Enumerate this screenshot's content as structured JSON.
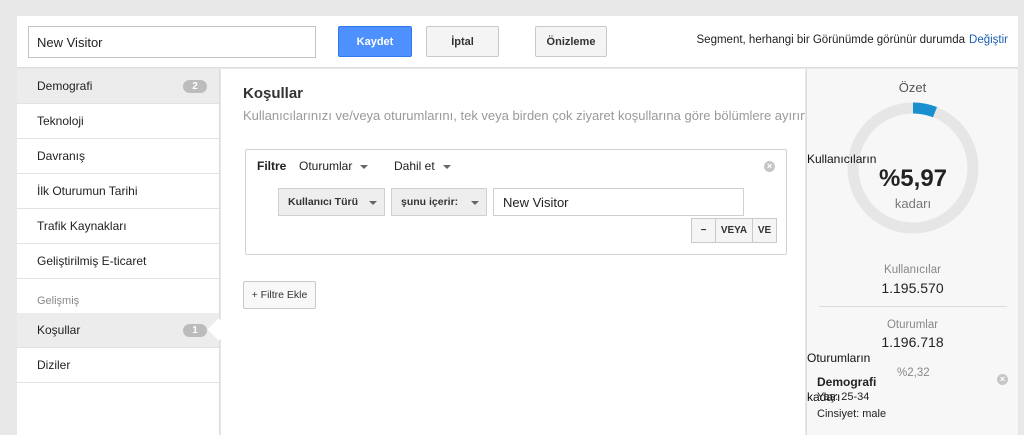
{
  "toolbar": {
    "segment_name": "New Visitor",
    "save_label": "Kaydet",
    "cancel_label": "İptal",
    "preview_label": "Önizleme",
    "visibility_text": "Segment, herhangi bir Görünümde görünür durumda",
    "change_link": "Değiştir"
  },
  "sidebar": {
    "items": [
      {
        "label": "Demografi",
        "badge": "2"
      },
      {
        "label": "Teknoloji"
      },
      {
        "label": "Davranış"
      },
      {
        "label": "İlk Oturumun Tarihi"
      },
      {
        "label": "Trafik Kaynakları"
      },
      {
        "label": "Geliştirilmiş E-ticaret"
      }
    ],
    "advanced_header": "Gelişmiş",
    "advanced_items": [
      {
        "label": "Koşullar",
        "badge": "1"
      },
      {
        "label": "Diziler"
      }
    ]
  },
  "main": {
    "title": "Koşullar",
    "description": "Kullanıcılarınızı ve/veya oturumlarını, tek veya birden çok ziyaret koşullarına göre bölümlere ayırın",
    "filter": {
      "label": "Filtre",
      "scope": "Oturumlar",
      "mode": "Dahil et",
      "dimension": "Kullanıcı Türü",
      "operator": "şunu içerir:",
      "value": "New Visitor",
      "minus_label": "−",
      "or_label": "VEYA",
      "and_label": "VE"
    },
    "add_filter_label": "+ Filtre Ekle"
  },
  "summary": {
    "title": "Özet",
    "gauge_percent": "%5,97",
    "gauge_fraction": 0.0597,
    "gauge_unit": "kadarı",
    "gauge_overlay": "Kullanıcıların",
    "users_label": "Kullanıcılar",
    "users_value": "1.195.570",
    "sessions_label": "Oturumlar",
    "sessions_value": "1.196.718",
    "sessions_overlay": "Oturumların",
    "sessions_overlay2": "kadarı",
    "sessions_percent": "%2,32",
    "demo_title": "Demografi",
    "demo_age": "Yaş: 25-34",
    "demo_gender": "Cinsiyet: male"
  },
  "colors": {
    "accent": "#4d90fe",
    "gauge": "#1a8fd0",
    "link": "#1a5fb4"
  }
}
